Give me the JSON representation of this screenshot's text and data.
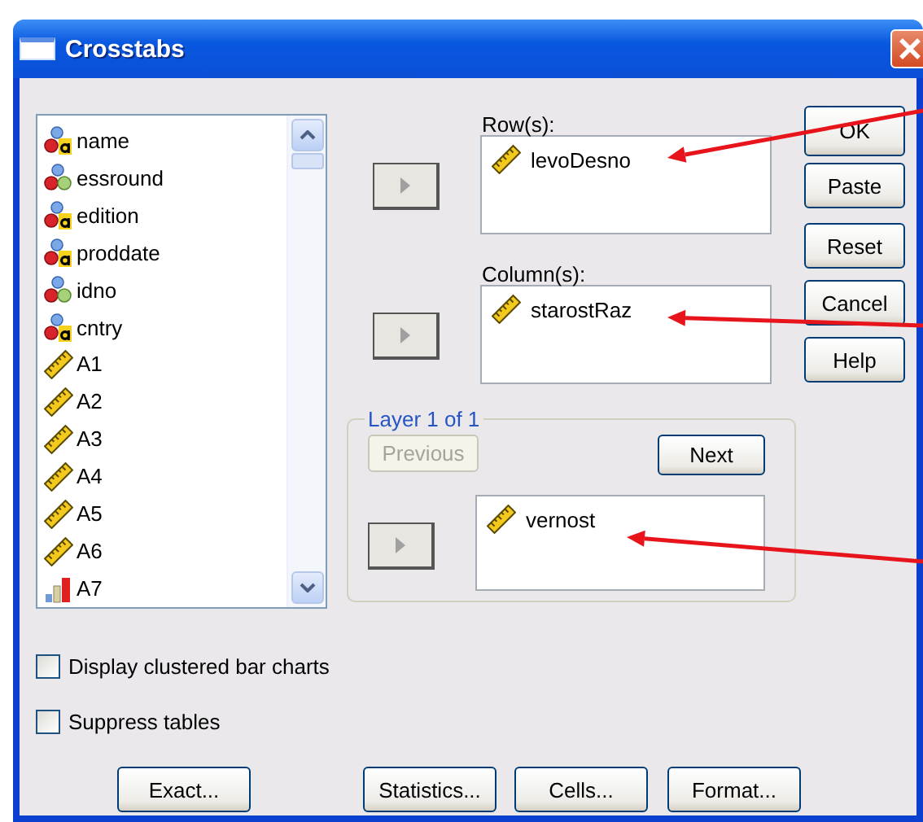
{
  "window": {
    "title": "Crosstabs"
  },
  "variables": [
    {
      "name": "name",
      "kind": "nominal_string"
    },
    {
      "name": "essround",
      "kind": "nominal"
    },
    {
      "name": "edition",
      "kind": "nominal_string"
    },
    {
      "name": "proddate",
      "kind": "nominal_string"
    },
    {
      "name": "idno",
      "kind": "nominal"
    },
    {
      "name": "cntry",
      "kind": "nominal_string"
    },
    {
      "name": "A1",
      "kind": "scale"
    },
    {
      "name": "A2",
      "kind": "scale"
    },
    {
      "name": "A3",
      "kind": "scale"
    },
    {
      "name": "A4",
      "kind": "scale"
    },
    {
      "name": "A5",
      "kind": "scale"
    },
    {
      "name": "A6",
      "kind": "scale"
    },
    {
      "name": "A7",
      "kind": "ordinal"
    }
  ],
  "rows": {
    "label": "Row(s):",
    "items": [
      {
        "name": "levoDesno",
        "kind": "scale"
      }
    ]
  },
  "columns": {
    "label": "Column(s):",
    "items": [
      {
        "name": "starostRaz",
        "kind": "scale"
      }
    ]
  },
  "layer": {
    "label": "Layer 1 of 1",
    "previous": {
      "label": "Previous",
      "disabled": true
    },
    "next": {
      "label": "Next",
      "disabled": false
    },
    "items": [
      {
        "name": "vernost",
        "kind": "scale"
      }
    ]
  },
  "side_buttons": [
    {
      "label": "OK"
    },
    {
      "label": "Paste"
    },
    {
      "label": "Reset"
    },
    {
      "label": "Cancel"
    },
    {
      "label": "Help"
    }
  ],
  "options": [
    {
      "label": "Display clustered bar charts",
      "checked": false
    },
    {
      "label": "Suppress tables",
      "checked": false
    }
  ],
  "bottom_buttons": [
    {
      "label": "Exact..."
    },
    {
      "label": "Statistics..."
    },
    {
      "label": "Cells..."
    },
    {
      "label": "Format..."
    }
  ]
}
